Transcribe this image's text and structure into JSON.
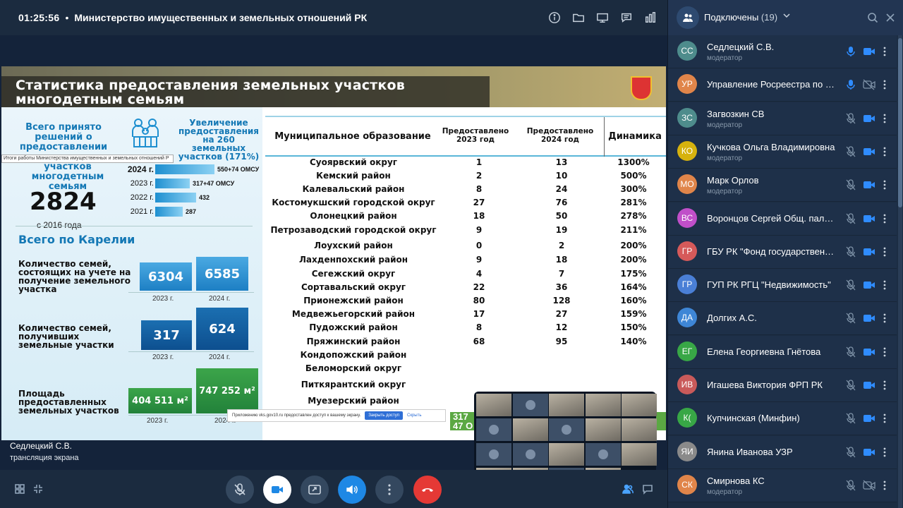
{
  "topbar": {
    "time": "01:25:56",
    "separator": "•",
    "title": "Министерство имущественных и земельных отношений РК",
    "icons": [
      "info-icon",
      "folder-icon",
      "screen-share-icon",
      "chat-icon",
      "stats-icon"
    ]
  },
  "slide": {
    "title": "Статистика предоставления земельных участков многодетным семьям",
    "left": {
      "decisions_label": "Всего принято решений о предоставлении",
      "increase_label": "Увеличение предоставления на 260 земельных участков (171%)",
      "tooltip": "Итоги работы Министерства имущественных и земельных отношений Р",
      "plots_label": "участков многодетным семьям",
      "total": "2824",
      "since": "с 2016 года",
      "years": [
        {
          "year": "2024 г.",
          "value": "550+74 ОМСУ",
          "amount": 624
        },
        {
          "year": "2023 г.",
          "value": "317+47 ОМСУ",
          "amount": 364
        },
        {
          "year": "2022 г.",
          "value": "432",
          "amount": 432
        },
        {
          "year": "2021 г.",
          "value": "287",
          "amount": 287
        }
      ],
      "karelia_title": "Всего по Карелии",
      "metrics": [
        {
          "label": "Количество семей, состоящих на учете на получение земельного участка",
          "v2023": "6304",
          "v2024": "6585",
          "y2023": "2023 г.",
          "y2024": "2024 г."
        },
        {
          "label": "Количество семей, получивших земельные участки",
          "v2023": "317",
          "v2024": "624",
          "y2023": "2023 г.",
          "y2024": "2024 г."
        },
        {
          "label": "Площадь предоставленных земельных участков",
          "v2023": "404 511 м²",
          "v2024": "747 252 м²",
          "y2023": "2023 г.",
          "y2024": "2024 г."
        }
      ]
    },
    "table": {
      "col_name": "Муниципальное образование",
      "col_2023": "Предоставлено 2023 год",
      "col_2024": "Предоставлено 2024 год",
      "col_dyn": "Динамика",
      "rows": [
        {
          "name": "Суоярвский округ",
          "a": "1",
          "b": "13",
          "c": "1300%"
        },
        {
          "name": "Кемский район",
          "a": "2",
          "b": "10",
          "c": "500%"
        },
        {
          "name": "Калевальский район",
          "a": "8",
          "b": "24",
          "c": "300%"
        },
        {
          "name": "Костомукшский городской округ",
          "a": "27",
          "b": "76",
          "c": "281%"
        },
        {
          "name": "Олонецкий район",
          "a": "18",
          "b": "50",
          "c": "278%"
        },
        {
          "name": "Петрозаводский городской округ",
          "a": "9",
          "b": "19",
          "c": "211%"
        },
        {
          "name": "Лоухский район",
          "a": "0",
          "b": "2",
          "c": "200%"
        },
        {
          "name": "Лахденпохский район",
          "a": "9",
          "b": "18",
          "c": "200%"
        },
        {
          "name": "Сегежский округ",
          "a": "4",
          "b": "7",
          "c": "175%"
        },
        {
          "name": "Сортавальский округ",
          "a": "22",
          "b": "36",
          "c": "164%"
        },
        {
          "name": "Прионежский район",
          "a": "80",
          "b": "128",
          "c": "160%"
        },
        {
          "name": "Медвежьегорский район",
          "a": "17",
          "b": "27",
          "c": "159%"
        },
        {
          "name": "Пудожский район",
          "a": "8",
          "b": "12",
          "c": "150%"
        },
        {
          "name": "Пряжинский район",
          "a": "68",
          "b": "95",
          "c": "140%"
        },
        {
          "name": "Кондопожский район",
          "a": "",
          "b": "",
          "c": ""
        },
        {
          "name": "Беломорский округ",
          "a": "",
          "b": "",
          "c": ""
        },
        {
          "name": "Питкярантский округ",
          "a": "",
          "b": "",
          "c": ""
        },
        {
          "name": "Муезерский район",
          "a": "",
          "b": "",
          "c": ""
        }
      ],
      "total_partial": "317",
      "total_partial2": "47 О"
    },
    "share_notice": {
      "text": "Приложению vks.gov10.ru предоставлен доступ к вашему экрану.",
      "close_button": "Закрыть доступ",
      "hide_link": "Скрыть"
    }
  },
  "speaker": {
    "name": "Седлецкий С.В.",
    "status": "трансляция экрана"
  },
  "bottombar": {
    "left_icons": [
      "grid-view-icon",
      "collapse-icon"
    ],
    "controls": [
      "microphone-off-icon",
      "camera-icon",
      "share-screen-icon",
      "speaker-icon",
      "more-icon",
      "hangup-icon"
    ],
    "right_icons": [
      "participants-icon",
      "chat-icon"
    ]
  },
  "panel": {
    "title": "Подключены",
    "count": "(19)",
    "participants": [
      {
        "initials": "СС",
        "name": "Седлецкий С.В.",
        "role": "модератор",
        "color": "#4e8c8c",
        "mic": "on",
        "cam": "on"
      },
      {
        "initials": "УР",
        "name": "Управление Росреестра по Ре...",
        "role": "",
        "color": "#e0854a",
        "mic": "on",
        "cam": "off"
      },
      {
        "initials": "ЗС",
        "name": "Загвозкин СВ",
        "role": "модератор",
        "color": "#4e8c8c",
        "mic": "off",
        "cam": "on"
      },
      {
        "initials": "КО",
        "name": "Кучкова Ольга Владимировна",
        "role": "модератор",
        "color": "#d6b20e",
        "mic": "off",
        "cam": "on"
      },
      {
        "initials": "МО",
        "name": "Марк Орлов",
        "role": "модератор",
        "color": "#e0854a",
        "mic": "off",
        "cam": "on"
      },
      {
        "initials": "ВС",
        "name": "Воронцов Сергей Общ. палат...",
        "role": "",
        "color": "#c04fc9",
        "mic": "off",
        "cam": "on"
      },
      {
        "initials": "ГР",
        "name": "ГБУ РК \"Фонд государственно...",
        "role": "",
        "color": "#d65a5a",
        "mic": "off",
        "cam": "on"
      },
      {
        "initials": "ГР",
        "name": "ГУП РК РГЦ \"Недвижимость\"",
        "role": "",
        "color": "#4a7fd6",
        "mic": "off",
        "cam": "on"
      },
      {
        "initials": "ДА",
        "name": "Долгих А.С.",
        "role": "",
        "color": "#3e86d6",
        "mic": "off",
        "cam": "on"
      },
      {
        "initials": "ЕГ",
        "name": "Елена Георгиевна Гнётова",
        "role": "",
        "color": "#38a746",
        "mic": "off",
        "cam": "on"
      },
      {
        "initials": "ИВ",
        "name": "Игашева Виктория ФРП РК",
        "role": "",
        "color": "#c95a5a",
        "mic": "off",
        "cam": "on"
      },
      {
        "initials": "К(",
        "name": "Купчинская (Минфин)",
        "role": "",
        "color": "#38a746",
        "mic": "off",
        "cam": "on"
      },
      {
        "initials": "ЯИ",
        "name": "Янина Иванова УЗР",
        "role": "",
        "color": "#8a8a8a",
        "mic": "off",
        "cam": "on"
      },
      {
        "initials": "СК",
        "name": "Смирнова КС",
        "role": "модератор",
        "color": "#e0854a",
        "mic": "off",
        "cam": "off"
      }
    ]
  }
}
